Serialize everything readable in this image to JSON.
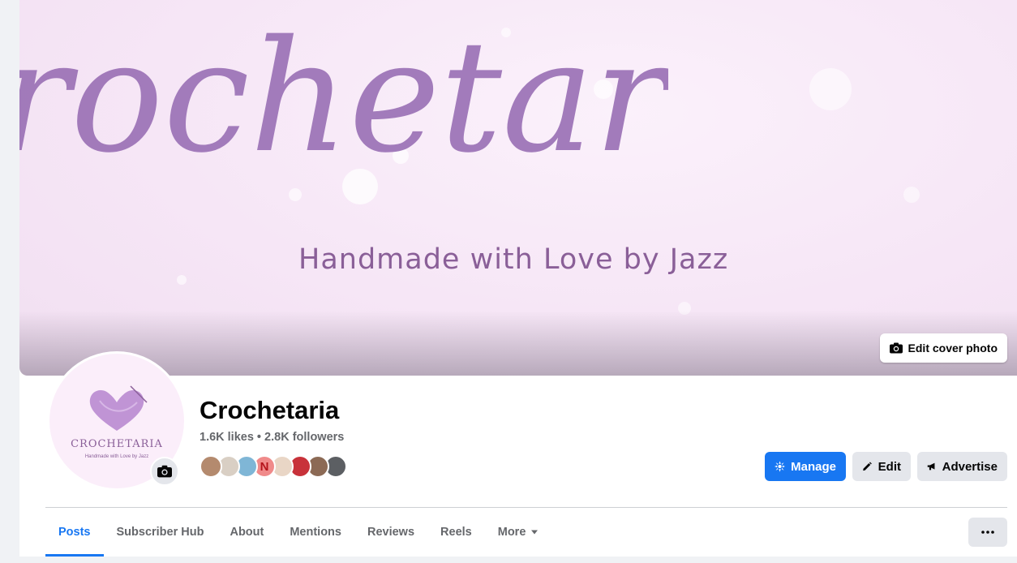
{
  "cover": {
    "script_title": "Crochetaria",
    "tagline": "Handmade with Love by Jazz",
    "edit_cover_label": "Edit cover photo",
    "icon": "camera-icon"
  },
  "avatar": {
    "brand": "CROCHETARIA",
    "sub": "Handmade with Love by Jazz",
    "camera_icon": "camera-icon"
  },
  "page": {
    "name": "Crochetaria",
    "stats": "1.6K likes • 2.8K followers"
  },
  "followers_faces": [
    {
      "color": "#b48a6e",
      "label": ""
    },
    {
      "color": "#d9cfc4",
      "label": ""
    },
    {
      "color": "#7fb6d6",
      "label": ""
    },
    {
      "color": "#f08a8a",
      "label": "N"
    },
    {
      "color": "#e9d6c6",
      "label": ""
    },
    {
      "color": "#c8323a",
      "label": ""
    },
    {
      "color": "#8c6a55",
      "label": ""
    },
    {
      "color": "#5c5f63",
      "label": ""
    }
  ],
  "actions": {
    "manage": "Manage",
    "edit": "Edit",
    "advertise": "Advertise"
  },
  "tabs": [
    {
      "label": "Posts",
      "active": true
    },
    {
      "label": "Subscriber Hub",
      "active": false
    },
    {
      "label": "About",
      "active": false
    },
    {
      "label": "Mentions",
      "active": false
    },
    {
      "label": "Reviews",
      "active": false
    },
    {
      "label": "Reels",
      "active": false
    },
    {
      "label": "More",
      "active": false
    }
  ],
  "colors": {
    "accent": "#1877f2",
    "cover_text": "#8a5f98",
    "secondary_text": "#65676b"
  }
}
